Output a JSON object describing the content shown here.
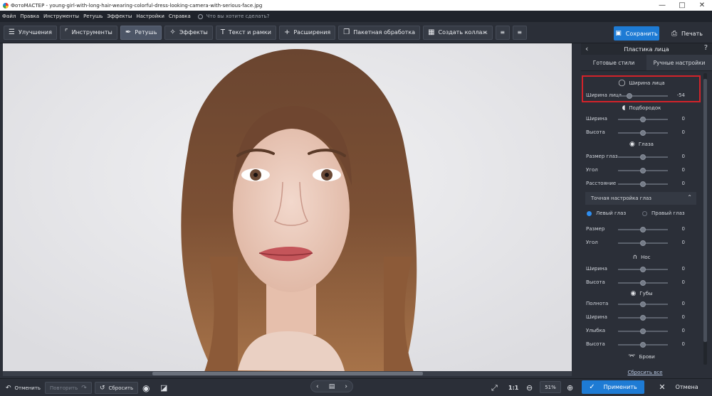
{
  "window": {
    "title": "ФотоМАСТЕР - young-girl-with-long-hair-wearing-colorful-dress-looking-camera-with-serious-face.jpg"
  },
  "menu": {
    "items": [
      "Файл",
      "Правка",
      "Инструменты",
      "Ретушь",
      "Эффекты",
      "Настройки",
      "Справка"
    ],
    "search_placeholder": "Что вы хотите сделать?"
  },
  "toolbar": {
    "tabs": [
      {
        "label": "Улучшения",
        "icon": "sliders-icon"
      },
      {
        "label": "Инструменты",
        "icon": "crop-icon"
      },
      {
        "label": "Ретушь",
        "icon": "brush-icon",
        "active": true
      },
      {
        "label": "Эффекты",
        "icon": "sparkle-icon"
      },
      {
        "label": "Текст и рамки",
        "icon": "text-icon"
      },
      {
        "label": "Расширения",
        "icon": "plus-icon"
      }
    ],
    "batch_label": "Пакетная обработка",
    "collage_label": "Создать коллаж",
    "save_label": "Сохранить",
    "print_label": "Печать"
  },
  "panel": {
    "title": "Пластика лица",
    "tabs": [
      {
        "label": "Готовые стили"
      },
      {
        "label": "Ручные настройки",
        "active": true
      }
    ],
    "sections": {
      "face": {
        "title": "Ширина лица",
        "icon": "face-icon"
      },
      "chin": {
        "title": "Подбородок",
        "icon": "chin-icon"
      },
      "eyes": {
        "title": "Глаза",
        "icon": "eye-icon"
      },
      "nose": {
        "title": "Нос",
        "icon": "nose-icon"
      },
      "lips": {
        "title": "Губы",
        "icon": "lips-icon"
      },
      "brows": {
        "title": "Брови",
        "icon": "brows-icon"
      }
    },
    "sliders": {
      "face_width": {
        "label": "Ширина лица",
        "value": "-54",
        "level": 0.23
      },
      "chin_width": {
        "label": "Ширина",
        "value": "0",
        "level": 0.5
      },
      "chin_height": {
        "label": "Высота",
        "value": "0",
        "level": 0.5
      },
      "eye_size": {
        "label": "Размер глаз",
        "value": "0",
        "level": 0.5
      },
      "eye_angle": {
        "label": "Угол",
        "value": "0",
        "level": 0.5
      },
      "eye_distance": {
        "label": "Расстояние",
        "value": "0",
        "level": 0.5
      },
      "fine_size": {
        "label": "Размер",
        "value": "0",
        "level": 0.5
      },
      "fine_angle": {
        "label": "Угол",
        "value": "0",
        "level": 0.5
      },
      "nose_width": {
        "label": "Ширина",
        "value": "0",
        "level": 0.5
      },
      "nose_height": {
        "label": "Высота",
        "value": "0",
        "level": 0.5
      },
      "lips_fullness": {
        "label": "Полнота",
        "value": "0",
        "level": 0.5
      },
      "lips_width": {
        "label": "Ширина",
        "value": "0",
        "level": 0.5
      },
      "lips_smile": {
        "label": "Улыбка",
        "value": "0",
        "level": 0.5
      },
      "lips_height": {
        "label": "Высота",
        "value": "0",
        "level": 0.5
      }
    },
    "eye_fine_tune": {
      "label": "Точная настройка глаз",
      "left_eye": "Левый глаз",
      "right_eye": "Правый глаз",
      "selected": "left"
    },
    "reset_all": "Сбросить все"
  },
  "bottom": {
    "undo_label": "Отменить",
    "redo_label": "Повторить",
    "reset_label": "Сбросить",
    "ratio_label": "1:1",
    "zoom": "51%",
    "apply_label": "Применить",
    "cancel_label": "Отмена"
  },
  "colors": {
    "accent": "#1e7bd4",
    "highlight": "#d2232a",
    "panel_bg": "#2b2f38"
  }
}
